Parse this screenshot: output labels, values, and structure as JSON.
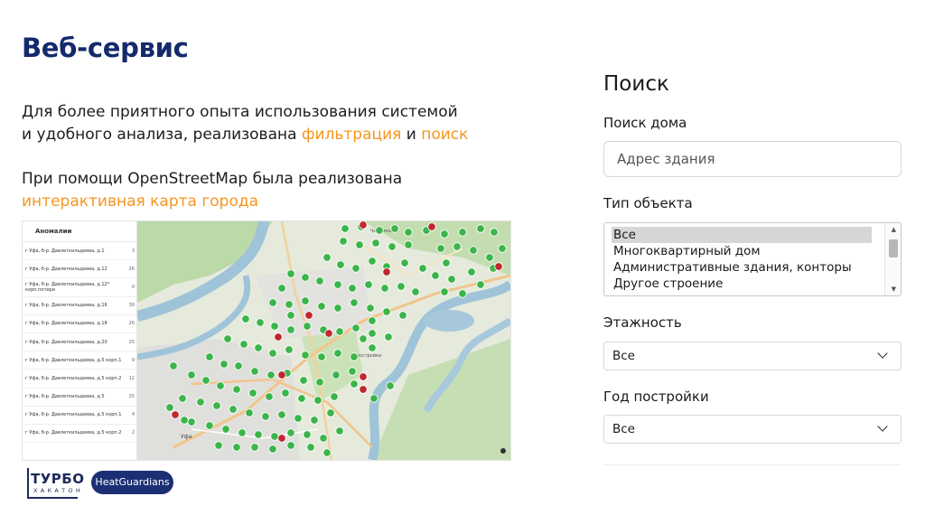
{
  "slide": {
    "title": "Веб-сервис",
    "para1_line1": "Для более приятного опыта использования системой",
    "para1_line2_pre": "и удобного анализа, реализована ",
    "para1_accent1": "фильтрация",
    "para1_mid": " и ",
    "para1_accent2": "поиск",
    "para2_line1": "При помощи OpenStreetMap была реализована",
    "para2_accent": "интерактивная карта города"
  },
  "anomalies": {
    "header": "Аномалии",
    "rows": [
      {
        "address": "г Уфа, б-р. Давлеткильдеева, д.1",
        "count": "3"
      },
      {
        "address": "г Уфа, б-р. Давлеткильдеева, д.12",
        "count": "26"
      },
      {
        "address": "г Уфа, б-р. Давлеткильдеева, д.12* корп.потери",
        "count": "0"
      },
      {
        "address": "г Уфа, б-р. Давлеткильдеева, д.16",
        "count": "30"
      },
      {
        "address": "г Уфа, б-р. Давлеткильдеева, д.18",
        "count": "26"
      },
      {
        "address": "г Уфа, б-р. Давлеткильдеева, д.20",
        "count": "25"
      },
      {
        "address": "г Уфа, б-р. Давлеткильдеева, д.5 корп.1",
        "count": "9"
      },
      {
        "address": "г Уфа, б-р. Давлеткильдеева, д.5 корп.2",
        "count": "12"
      },
      {
        "address": "г Уфа, б-р. Давлеткильдеева, д.5",
        "count": "25"
      },
      {
        "address": "г Уфа, б-р. Давлеткильдеева, д.5 корп.1",
        "count": "4"
      },
      {
        "address": "г Уфа, б-р. Давлеткильдеева, д.5 корп.2",
        "count": "2"
      }
    ]
  },
  "map": {
    "water_color": "#9fc3d8",
    "park_color": "#bcd9a8",
    "road_color": "#f2c48b",
    "normal_marker_color": "#3bb54a",
    "anomaly_marker_color": "#c0272d",
    "place_labels": [
      "Уфа",
      "Новостройки",
      "Черниковка"
    ]
  },
  "search_panel": {
    "title": "Поиск",
    "house_search_label": "Поиск дома",
    "house_search_placeholder": "Адрес здания",
    "object_type_label": "Тип объекта",
    "object_type_options": [
      "Все",
      "Многоквартирный дом",
      "Административные здания, конторы",
      "Другое строение"
    ],
    "floors_label": "Этажность",
    "floors_value": "Все",
    "year_label": "Год постройки",
    "year_value": "Все"
  },
  "footer": {
    "logo_title": "ТУРБО",
    "logo_subtitle": "ХАКАТОН",
    "team_name": "HeatGuardians"
  }
}
